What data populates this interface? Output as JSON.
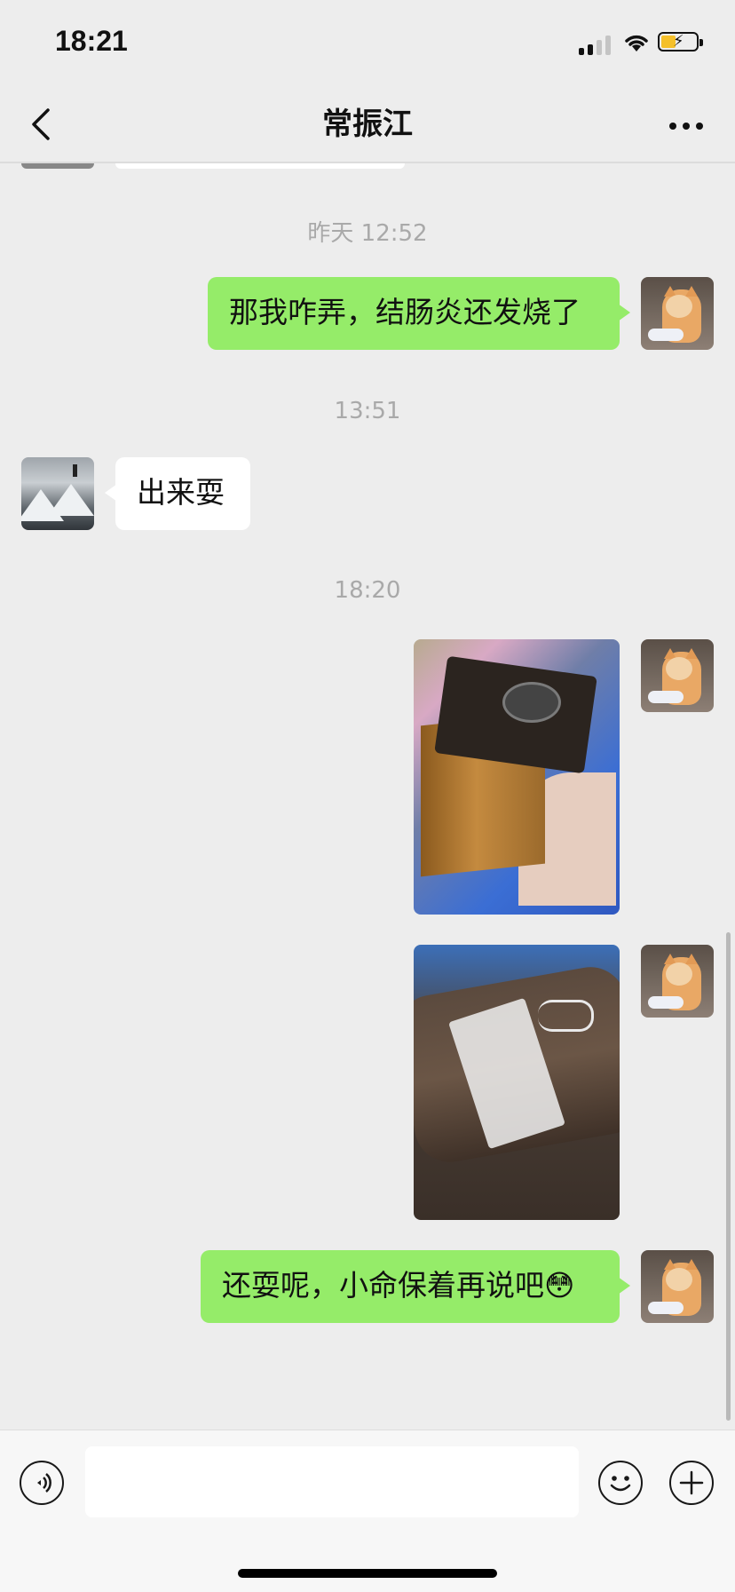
{
  "status_bar": {
    "time": "18:21"
  },
  "nav": {
    "title": "常振江"
  },
  "messages": {
    "ts1": "昨天 12:52",
    "m1": "那我咋弄，结肠炎还发烧了",
    "ts2": "13:51",
    "m2": "出来耍",
    "ts3": "18:20",
    "m5": "还耍呢，小命保着再说吧😳"
  },
  "input": {
    "placeholder": ""
  },
  "colors": {
    "sent_bubble": "#95ec69",
    "received_bubble": "#ffffff",
    "background": "#ededed"
  }
}
